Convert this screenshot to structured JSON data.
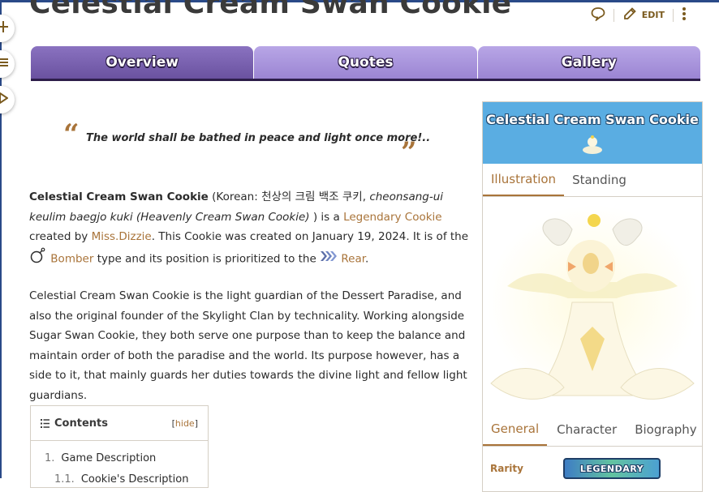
{
  "page": {
    "title": "Celestial Cream Swan Cookie",
    "actions": {
      "edit_label": "EDIT"
    }
  },
  "tabs": [
    {
      "label": "Overview"
    },
    {
      "label": "Quotes"
    },
    {
      "label": "Gallery"
    }
  ],
  "quote": {
    "open_mark": "“",
    "close_mark": "”",
    "text": "The world shall be bathed in peace and light once more!.."
  },
  "intro": {
    "name": "Celestial Cream Swan Cookie",
    "korean_prefix": " (Korean: 천상의 크림 백조 쿠키, ",
    "romanized": "cheonsang-ui keulim baegjo kuki (Heavenly Cream Swan Cookie)",
    "is_a": " ) is a ",
    "rarity_link": "Legendary Cookie",
    "created_by": " created by ",
    "creator_link": "Miss.Dizzie",
    "created_on": ". This Cookie was created on January 19, 2024. It is of the ",
    "type_link": "Bomber",
    "position_text": " type and its position is prioritized to the ",
    "position_link": "Rear",
    "end": "."
  },
  "description": "Celestial Cream Swan Cookie is the light guardian of the Dessert Paradise, and also the original founder of the Skylight Clan by technicality. Working alongside Sugar Swan Cookie, they both serve one purpose than to keep the balance and maintain order of both the paradise and the world. Its purpose however, has a side to it, that mainly guards her duties towards the divine light and fellow light guardians.",
  "toc": {
    "title": "Contents",
    "hide_open": "[",
    "hide_label": "hide",
    "hide_close": "]",
    "items": [
      {
        "num": "1.",
        "label": "Game Description"
      },
      {
        "num": "1.1.",
        "label": "Cookie's Description"
      }
    ]
  },
  "infobox": {
    "title": "Celestial Cream Swan Cookie",
    "image_tabs": [
      {
        "label": "Illustration"
      },
      {
        "label": "Standing"
      }
    ],
    "info_tabs": [
      {
        "label": "General"
      },
      {
        "label": "Character"
      },
      {
        "label": "Biography"
      }
    ],
    "rarity_label": "Rarity",
    "rarity_value": "LEGENDARY"
  },
  "colors": {
    "accent": "#a9743a",
    "tab_active": "#7a62b0",
    "tab_inactive": "#a994dc",
    "infobox_header": "#5aade2"
  },
  "icons": [
    "sparkle-icon",
    "list-icon",
    "tag-icon",
    "comment-icon",
    "pencil-icon",
    "more-vertical-icon",
    "bomb-icon",
    "rear-chevrons-icon",
    "toc-list-icon"
  ]
}
